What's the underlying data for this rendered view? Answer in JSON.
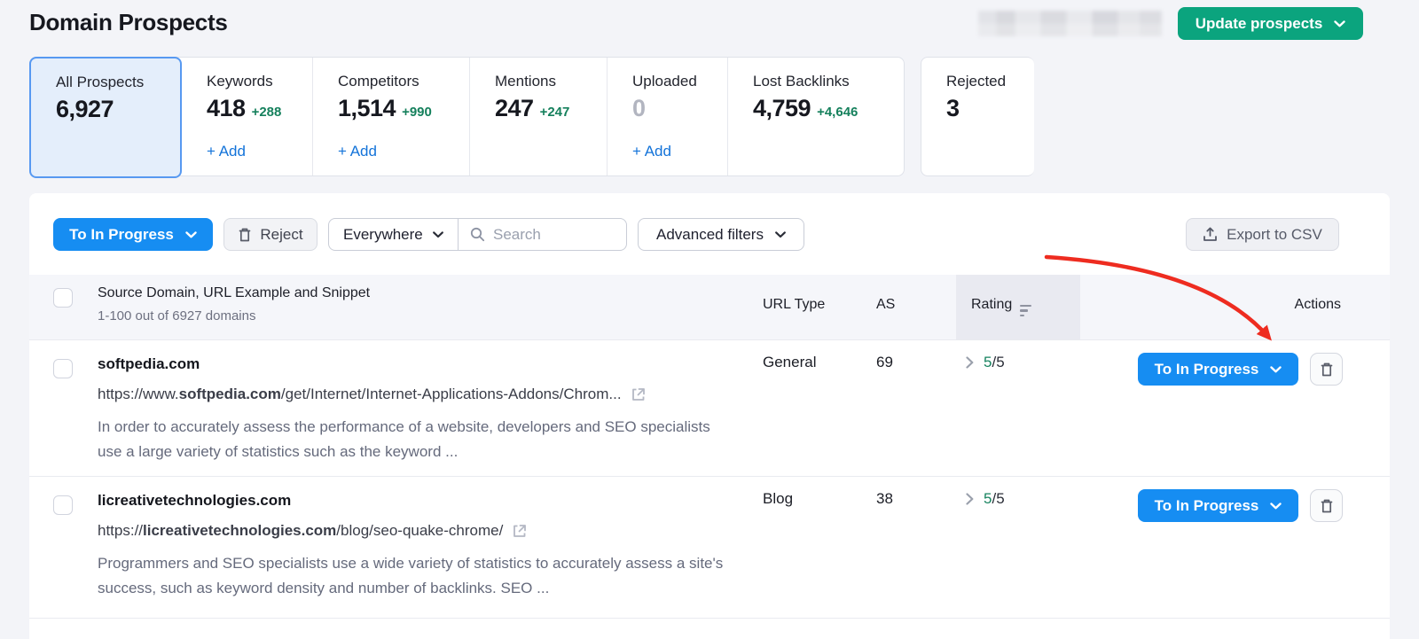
{
  "header": {
    "title": "Domain Prospects",
    "update_button": "Update prospects"
  },
  "labels": {
    "add": "+ Add"
  },
  "tabs": [
    {
      "label": "All Prospects",
      "value": "6,927",
      "delta": "",
      "selected": true
    },
    {
      "label": "Keywords",
      "value": "418",
      "delta": "+288"
    },
    {
      "label": "Competitors",
      "value": "1,514",
      "delta": "+990"
    },
    {
      "label": "Mentions",
      "value": "247",
      "delta": "+247"
    },
    {
      "label": "Uploaded",
      "value": "0",
      "delta": ""
    },
    {
      "label": "Lost Backlinks",
      "value": "4,759",
      "delta": "+4,646"
    },
    {
      "label": "Rejected",
      "value": "3",
      "delta": ""
    }
  ],
  "toolbar": {
    "to_in_progress": "To In Progress",
    "reject": "Reject",
    "everywhere": "Everywhere",
    "search_placeholder": "Search",
    "advanced_filters": "Advanced filters",
    "export_csv": "Export to CSV"
  },
  "table": {
    "header": {
      "main": "Source Domain, URL Example and Snippet",
      "count": "1-100 out of 6927 domains",
      "url_type": "URL Type",
      "as": "AS",
      "rating": "Rating",
      "actions": "Actions"
    },
    "rows": [
      {
        "domain": "softpedia.com",
        "url_prefix": "https://www.",
        "url_domain": "softpedia.com",
        "url_path": "/get/Internet/Internet-Applications-Addons/Chrom...",
        "snippet": "In order to accurately assess the performance of a website, developers and SEO specialists use a large variety of statistics such as the keyword ...",
        "url_type": "General",
        "as": "69",
        "rating_value": "5",
        "rating_total": "/5",
        "action": "To In Progress"
      },
      {
        "domain": "licreativetechnologies.com",
        "url_prefix": "https://",
        "url_domain": "licreativetechnologies.com",
        "url_path": "/blog/seo-quake-chrome/",
        "snippet": "Programmers and SEO specialists use a wide variety of statistics to accurately assess a site's success, such as keyword density and number of backlinks. SEO ...",
        "url_type": "Blog",
        "as": "38",
        "rating_value": "5",
        "rating_total": "/5",
        "action": "To In Progress"
      }
    ]
  },
  "colors": {
    "accent_blue": "#168df2",
    "accent_green": "#0ba47e",
    "link_blue": "#1373d9",
    "delta_green": "#15805c",
    "rating_green": "#17835f",
    "arrow_red": "#ee2c20",
    "selected_tab_bg": "#e4eefb",
    "selected_tab_border": "#5799f1"
  }
}
